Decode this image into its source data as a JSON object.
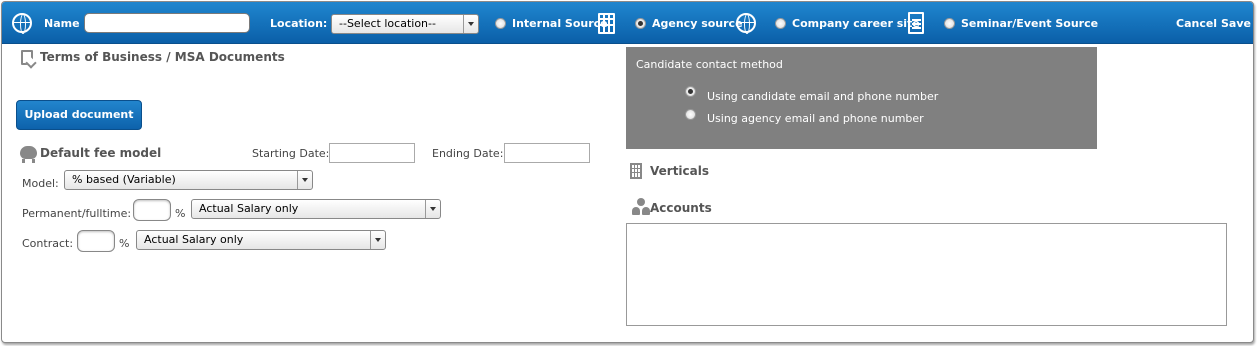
{
  "header": {
    "name_label": "Name",
    "name_value": "",
    "location_label": "Location:",
    "location_value": "--Select location--",
    "sources": [
      {
        "label": "Internal Source",
        "selected": false,
        "icon": "building-icon"
      },
      {
        "label": "Agency source",
        "selected": true,
        "icon": "globe-icon"
      },
      {
        "label": "Company career site",
        "selected": false,
        "icon": "document-icon"
      },
      {
        "label": "Seminar/Event Source",
        "selected": false,
        "icon": ""
      }
    ],
    "cancel_label": "Cancel",
    "save_label": "Save",
    "bar_color": "#1177c4"
  },
  "left": {
    "terms_title": "Terms of Business / MSA Documents",
    "upload_label": "Upload document",
    "fee_title": "Default fee model",
    "starting_date_label": "Starting Date:",
    "starting_date_value": "",
    "ending_date_label": "Ending Date:",
    "ending_date_value": "",
    "model_label": "Model:",
    "model_value": "% based (Variable)",
    "permanent_label": "Permanent/fulltime:",
    "permanent_value": "",
    "permanent_unit": "%",
    "permanent_basis": "Actual Salary only",
    "contract_label": "Contract:",
    "contract_value": "",
    "contract_unit": "%",
    "contract_basis": "Actual Salary only"
  },
  "right": {
    "contact_title": "Candidate contact method",
    "contact_options": [
      {
        "label": "Using candidate email and phone number",
        "selected": true
      },
      {
        "label": "Using agency email and phone number",
        "selected": false
      }
    ],
    "verticals_title": "Verticals",
    "accounts_title": "Accounts",
    "accounts_value": ""
  }
}
